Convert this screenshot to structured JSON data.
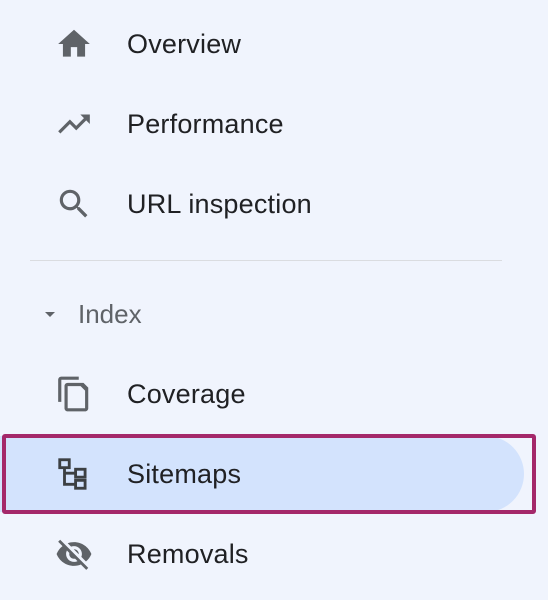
{
  "nav": {
    "items": [
      {
        "label": "Overview",
        "icon": "home-icon"
      },
      {
        "label": "Performance",
        "icon": "trending-up-icon"
      },
      {
        "label": "URL inspection",
        "icon": "search-icon"
      }
    ],
    "section": {
      "label": "Index",
      "icon": "caret-down-icon",
      "expanded": true,
      "items": [
        {
          "label": "Coverage",
          "icon": "copy-pages-icon"
        },
        {
          "label": "Sitemaps",
          "icon": "sitemap-tree-icon",
          "active": true
        },
        {
          "label": "Removals",
          "icon": "eye-off-icon"
        }
      ]
    }
  },
  "colors": {
    "background": "#f0f4fd",
    "active_item": "#d3e3fd",
    "highlight_border": "#a4286a",
    "text": "#202124",
    "muted_text": "#5f6368",
    "icon": "#5f6368"
  }
}
